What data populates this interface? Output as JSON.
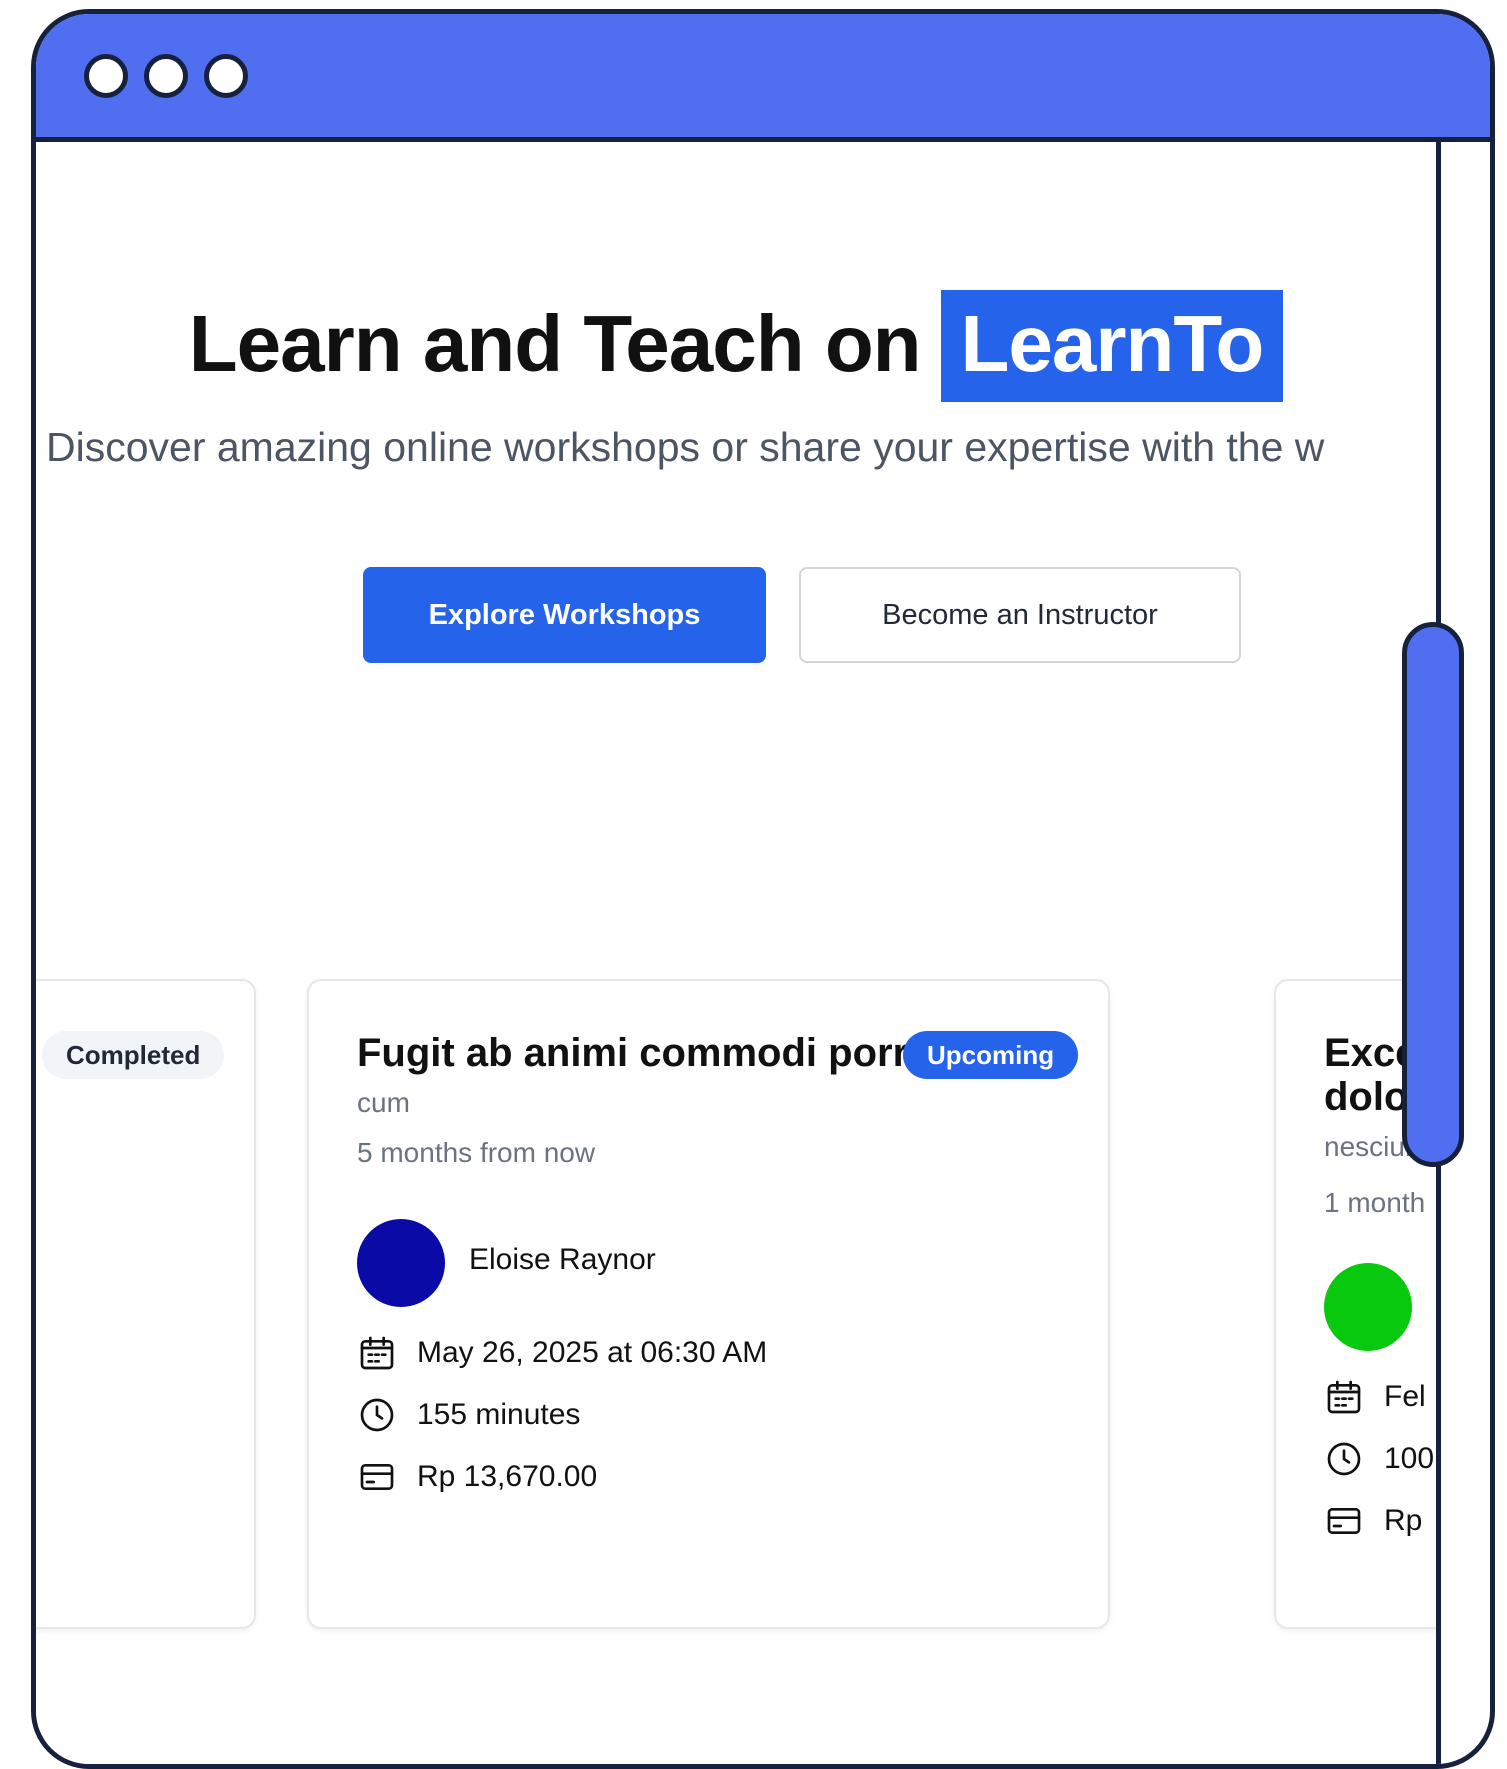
{
  "hero": {
    "title_prefix": "Learn and Teach on",
    "brand": "LearnTo",
    "subtitle": "Discover amazing online workshops or share your expertise with the w"
  },
  "actions": {
    "explore_label": "Explore Workshops",
    "instructor_label": "Become an Instructor"
  },
  "cards": [
    {
      "badge": "Completed"
    },
    {
      "title": "Fugit ab animi commodi porro.",
      "badge": "Upcoming",
      "category": "cum",
      "relative_time": "5 months from now",
      "instructor": "Eloise Raynor",
      "avatar_color": "#0a0aa6",
      "datetime": "May 26, 2025 at 06:30 AM",
      "duration": "155 minutes",
      "price": "Rp 13,670.00"
    },
    {
      "title_line1": "Excep",
      "title_line2": "dolor",
      "category": "nesciun",
      "relative_time": "1 month",
      "avatar_color": "#09c90f",
      "datetime": "Fel",
      "duration": "100",
      "price": "Rp"
    }
  ],
  "theme": {
    "accent": "#2563eb",
    "chrome": "#4f6ff0",
    "outline": "#17213d"
  }
}
